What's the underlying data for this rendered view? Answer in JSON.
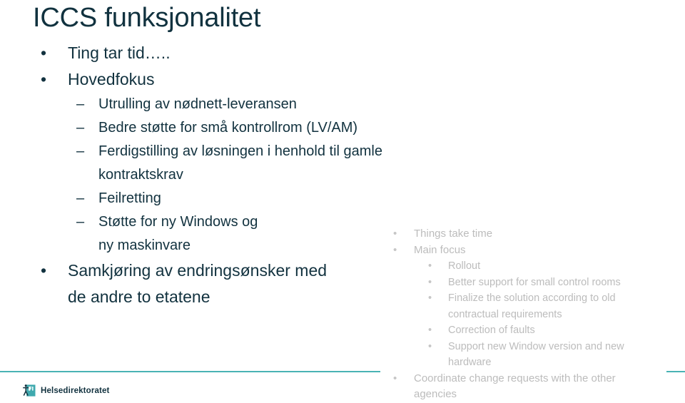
{
  "slide": {
    "title": "ICCS funksjonalitet",
    "title_color": "#11323f",
    "body_color": "#12323f",
    "translation_color": "#bcbcbc",
    "accent_color": "#49b3b4",
    "background_color": "#ffffff"
  },
  "bullets_no": [
    {
      "level": 1,
      "marker": "•",
      "text": "Ting tar tid….."
    },
    {
      "level": 1,
      "marker": "•",
      "text": "Hovedfokus"
    },
    {
      "level": 2,
      "marker": "–",
      "text": "Utrulling av nødnett-leveransen"
    },
    {
      "level": 2,
      "marker": "–",
      "text": "Bedre støtte for små kontrollrom (LV/AM)"
    },
    {
      "level": 2,
      "marker": "–",
      "text": "Ferdigstilling av løsningen i henhold til gamle kontraktskrav"
    },
    {
      "level": 2,
      "marker": "–",
      "text": "Feilretting"
    },
    {
      "level": 2,
      "marker": "–",
      "text": "Støtte for ny Windows og\nny maskinvare"
    },
    {
      "level": 1,
      "marker": "•",
      "text": "Samkjøring av endringsønsker med\nde andre to etatene"
    }
  ],
  "bullets_en": [
    {
      "level": 1,
      "marker": "•",
      "text": "Things take time"
    },
    {
      "level": 1,
      "marker": "•",
      "text": "Main focus"
    },
    {
      "level": 2,
      "marker": "•",
      "text": "Rollout"
    },
    {
      "level": 2,
      "marker": "•",
      "text": "Better support for small control rooms"
    },
    {
      "level": 2,
      "marker": "•",
      "text": "Finalize the solution according to old\ncontractual requirements"
    },
    {
      "level": 2,
      "marker": "•",
      "text": "Correction of faults"
    },
    {
      "level": 2,
      "marker": "•",
      "text": "Support new Window version and new\nhardware"
    },
    {
      "level": 1,
      "marker": "•",
      "text": "Coordinate change requests with the other\nagencies"
    }
  ],
  "footer": {
    "logo_text": "Helsedirektoratet",
    "logo_icon": "helsedirektoratet-logo-icon"
  }
}
